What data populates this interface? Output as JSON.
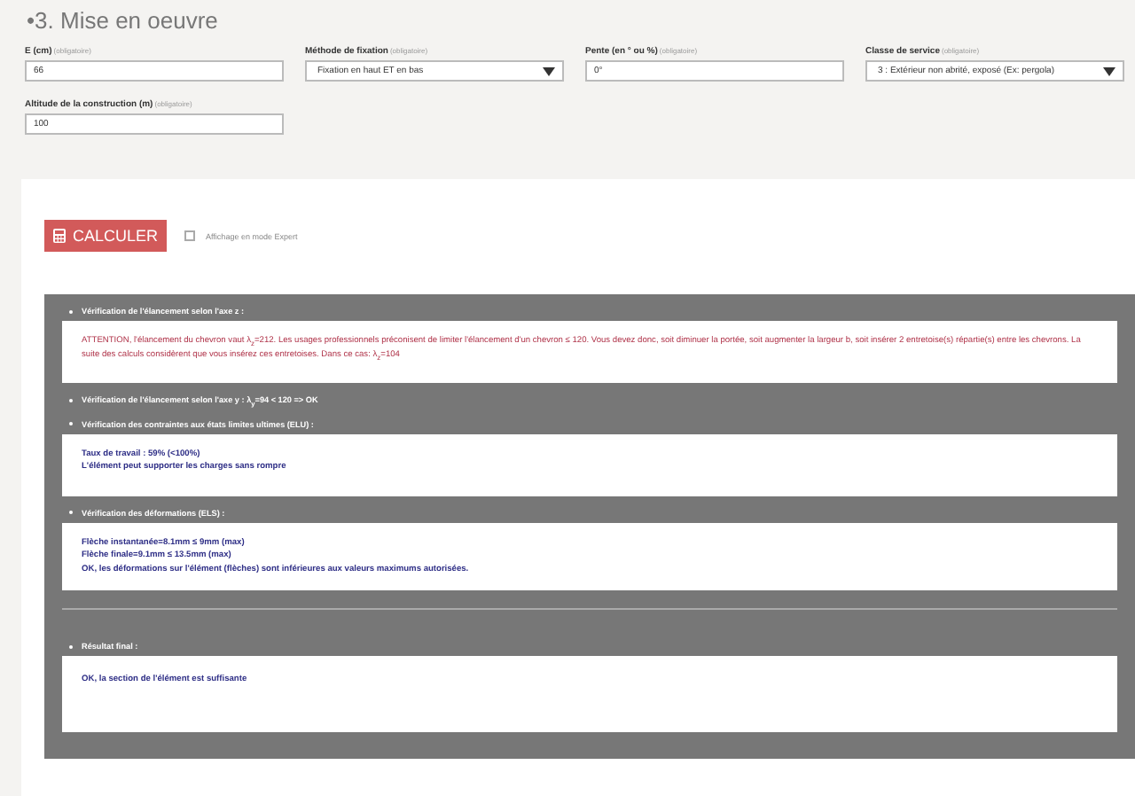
{
  "section_title": "•3. Mise en oeuvre",
  "fields": [
    {
      "kind": "text",
      "label": "E (cm)",
      "hint": "(obligatoire)",
      "value": "66"
    },
    {
      "kind": "select",
      "label": "Méthode de fixation",
      "hint": "(obligatoire)",
      "value": "Fixation en haut ET en bas"
    },
    {
      "kind": "text",
      "label": "Pente (en ° ou %)",
      "hint": "(obligatoire)",
      "value": "0°"
    },
    {
      "kind": "select",
      "label": "Classe de service",
      "hint": "(obligatoire)",
      "value": "3 : Extérieur non abrité, exposé (Ex: pergola)"
    },
    {
      "kind": "text",
      "label": "Altitude de la construction (m)",
      "hint": "(obligatoire)",
      "value": "100"
    }
  ],
  "calculate_button": "CALCULER",
  "expert_mode": {
    "label": "Affichage en mode Expert",
    "checked": false
  },
  "results": [
    {
      "heading": "Vérification de l'élancement selon l'axe z :",
      "lines": [
        {
          "kind": "warning",
          "text": "ATTENTION, l'élancement du chevron vaut λ$_{z}$=212. Les usages professionnels préconisent de limiter l'élancement d'un chevron ≤ 120. Vous devez donc, soit diminuer la portée, soit augmenter la largeur b, soit insérer 2 entretoise(s) répartie(s) entre les chevrons. La suite des calculs considèrent que vous insérez ces entretoises. Dans ce cas: λ$_{z}$=104"
        }
      ]
    },
    {
      "heading": "Vérification de l'élancement selon l'axe y : λ$_{y}$=94 < 120 => OK"
    },
    {
      "heading": "Vérification des contraintes aux états limites ultimes (ELU) :",
      "lines": [
        {
          "kind": "ok",
          "text": "Taux de travail : 59% (<100%)"
        },
        {
          "kind": "ok",
          "text": "L'élément peut supporter les charges sans rompre"
        }
      ]
    },
    {
      "heading": "Vérification des déformations (ELS) :",
      "lines": [
        {
          "kind": "ok",
          "text": "Flèche instantanée=8.1mm ≤ 9mm (max)"
        },
        {
          "kind": "ok",
          "text": "Flèche finale=9.1mm ≤ 13.5mm (max)"
        },
        {
          "kind": "ok",
          "text": "OK, les déformations sur l'élément (flèches) sont inférieures aux valeurs maximums autorisées."
        }
      ]
    }
  ],
  "final": {
    "heading": "Résultat final :",
    "lines": [
      {
        "kind": "ok",
        "text": "OK, la section de l'élément est suffisante"
      }
    ]
  }
}
